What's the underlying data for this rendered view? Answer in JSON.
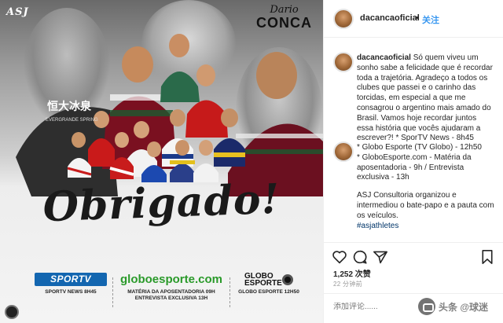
{
  "post": {
    "logo_text": "ASJ",
    "name_first": "Dario",
    "name_last": "CONCA",
    "headline": "Obrigado!",
    "sponsors": [
      {
        "logo": "SPORTV",
        "caption": "SPORTV NEWS 8H45"
      },
      {
        "logo": "globoesporte.com",
        "caption": "MATÉRIA DA APOSENTADORIA 09H ENTREVISTA EXCLUSIVA 13H"
      },
      {
        "logo": "GLOBO ESPORTE",
        "caption": "GLOBO ESPORTE 12H50"
      }
    ]
  },
  "header": {
    "username": "dacancaoficial",
    "dot": "•",
    "follow_label": "关注"
  },
  "caption": {
    "username": "dacancaoficial",
    "text": "Só quem viveu um sonho sabe a felicidade que é recordar toda a trajetória. Agradeço a todos os clubes que passei e o carinho das torcidas, em especial a que me consagrou o argentino mais amado do Brasil. Vamos hoje recordar juntos essa história que vocês ajudaram a escrever?! * SporTV News - 8h45"
  },
  "comment2": {
    "lines": [
      "* Globo Esporte (TV Globo) - 12h50",
      "* GloboEsporte.com - Matéria da aposentadoria - 9h / Entrevista exclusiva - 13h"
    ],
    "paragraph": "ASJ Consultoria organizou e intermediou o bate-papo e a pauta com os veículos.",
    "hashtag": "#asjathletes"
  },
  "actions": {
    "likes": "1,252 次赞",
    "time": "22 分钟前",
    "comment_placeholder": "添加评论......"
  },
  "watermark": {
    "text": "头条 @球迷"
  },
  "colors": {
    "link_blue": "#3897f0",
    "text": "#262626",
    "muted": "#999999",
    "sportv_blue": "#1366b0",
    "globo_green": "#2a9a2a"
  }
}
